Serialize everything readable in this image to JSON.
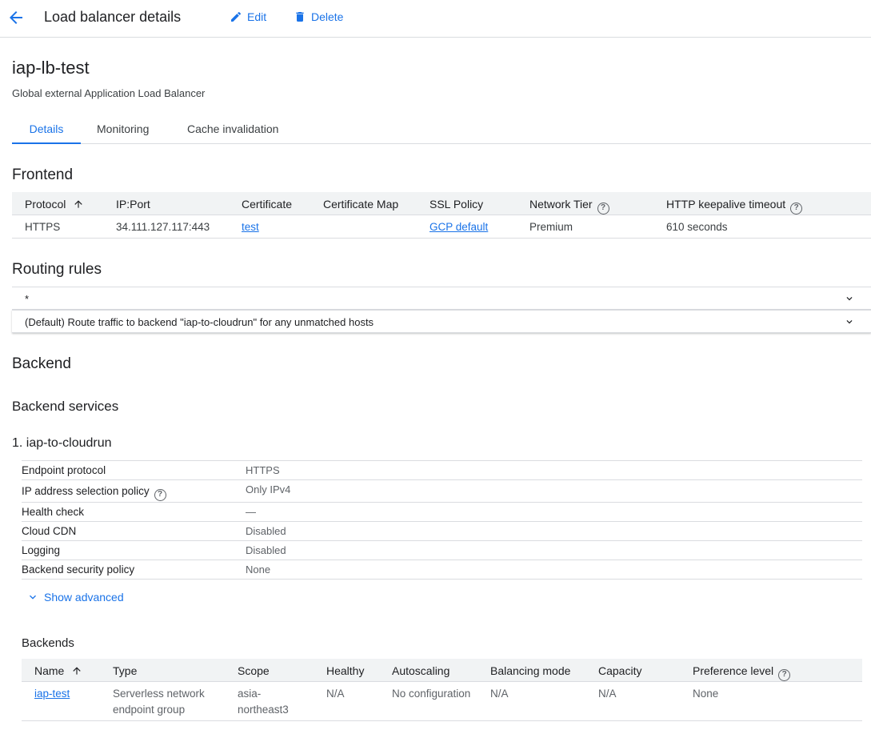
{
  "header": {
    "title": "Load balancer details",
    "edit_label": "Edit",
    "delete_label": "Delete"
  },
  "lb": {
    "name": "iap-lb-test",
    "type": "Global external Application Load Balancer"
  },
  "tabs": [
    {
      "label": "Details",
      "active": true
    },
    {
      "label": "Monitoring"
    },
    {
      "label": "Cache invalidation"
    }
  ],
  "frontend": {
    "heading": "Frontend",
    "columns": [
      "Protocol",
      "IP:Port",
      "Certificate",
      "Certificate Map",
      "SSL Policy",
      "Network Tier",
      "HTTP keepalive timeout"
    ],
    "rows": [
      {
        "protocol": "HTTPS",
        "ip_port": "34.111.127.117:443",
        "certificate": "test",
        "certificate_map": "",
        "ssl_policy": "GCP default",
        "network_tier": "Premium",
        "keepalive": "610 seconds"
      }
    ]
  },
  "routing": {
    "heading": "Routing rules",
    "rules": [
      "*",
      "(Default) Route traffic to backend \"iap-to-cloudrun\" for any unmatched hosts"
    ]
  },
  "backend": {
    "heading": "Backend",
    "services_heading": "Backend services",
    "service_title": "1. iap-to-cloudrun",
    "properties": [
      {
        "key": "Endpoint protocol",
        "value": "HTTPS"
      },
      {
        "key": "IP address selection policy",
        "value": "Only IPv4",
        "help": true
      },
      {
        "key": "Health check",
        "value": "—"
      },
      {
        "key": "Cloud CDN",
        "value": "Disabled"
      },
      {
        "key": "Logging",
        "value": "Disabled"
      },
      {
        "key": "Backend security policy",
        "value": "None"
      }
    ],
    "show_advanced": "Show advanced",
    "backends_title": "Backends",
    "backends_columns": [
      "Name",
      "Type",
      "Scope",
      "Healthy",
      "Autoscaling",
      "Balancing mode",
      "Capacity",
      "Preference level"
    ],
    "backends_rows": [
      {
        "name": "iap-test",
        "type": "Serverless network endpoint group",
        "scope": "asia-northeast3",
        "healthy": "N/A",
        "autoscaling": "No configuration",
        "balancing_mode": "N/A",
        "capacity": "N/A",
        "preference": "None"
      }
    ]
  },
  "icons": {
    "back": "arrow-back-icon",
    "edit": "pencil-icon",
    "delete": "trash-icon",
    "sort": "arrow-up-icon",
    "help": "help-circle-icon",
    "expand": "chevron-down-icon"
  },
  "colors": {
    "accent": "#1a73e8",
    "header_bg": "#f1f3f4",
    "divider": "#dadce0"
  }
}
